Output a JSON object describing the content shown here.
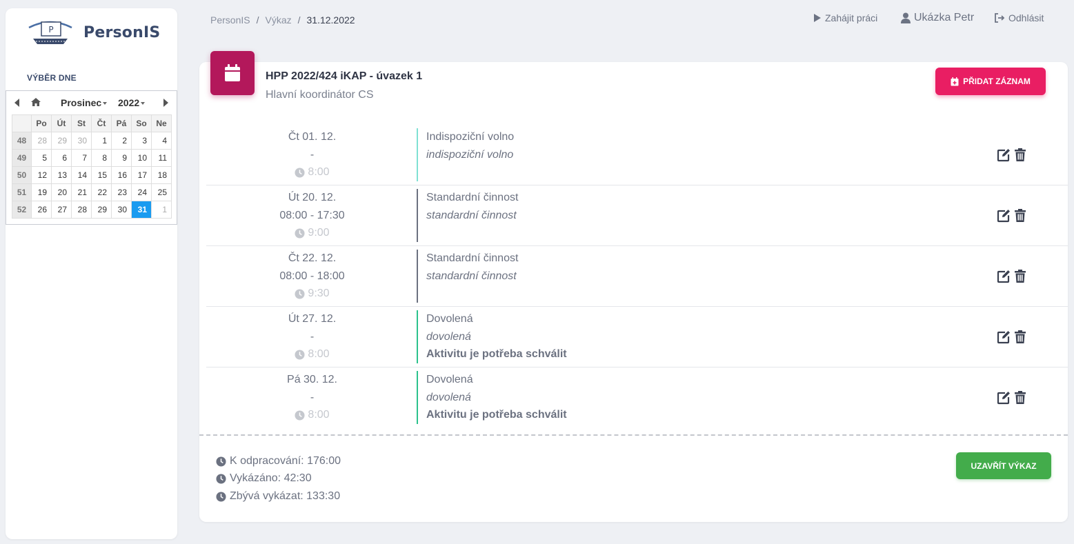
{
  "app": {
    "name": "PersonIS",
    "logo_letter": "P"
  },
  "sidebar": {
    "heading": "VÝBĚR DNE",
    "calendar": {
      "month": "Prosinec",
      "year": "2022",
      "weekdays": [
        "Po",
        "Út",
        "St",
        "Čt",
        "Pá",
        "So",
        "Ne"
      ],
      "weeks": [
        {
          "num": "48",
          "days": [
            "28",
            "29",
            "30",
            "1",
            "2",
            "3",
            "4"
          ]
        },
        {
          "num": "49",
          "days": [
            "5",
            "6",
            "7",
            "8",
            "9",
            "10",
            "11"
          ]
        },
        {
          "num": "50",
          "days": [
            "12",
            "13",
            "14",
            "15",
            "16",
            "17",
            "18"
          ]
        },
        {
          "num": "51",
          "days": [
            "19",
            "20",
            "21",
            "22",
            "23",
            "24",
            "25"
          ]
        },
        {
          "num": "52",
          "days": [
            "26",
            "27",
            "28",
            "29",
            "30",
            "31",
            "1"
          ]
        }
      ],
      "selected_day": "31",
      "selected_color": "#1a9bf0"
    }
  },
  "breadcrumb": {
    "items": [
      "PersonIS",
      "Výkaz"
    ],
    "current": "31.12.2022",
    "separator": "/"
  },
  "topnav": {
    "start_work": "Zahájit práci",
    "user": "Ukázka Petr",
    "logout": "Odhlásit"
  },
  "card": {
    "title": "HPP 2022/424 iKAP - úvazek 1",
    "subtitle": "Hlavní koordinátor CS",
    "add_button": "PŘIDAT ZÁZNAM",
    "icon": "calendar-icon",
    "icon_color": "#b3185b",
    "add_button_color": "#e91e63"
  },
  "entries": [
    {
      "date": "Čt 01. 12.",
      "time": "-",
      "hours": "8:00",
      "type": "Indispoziční volno",
      "desc": "indispoziční volno",
      "note": "",
      "bar_color": "#7fe0d3"
    },
    {
      "date": "Út 20. 12.",
      "time": "08:00 - 17:30",
      "hours": "9:00",
      "type": "Standardní činnost",
      "desc": "standardní činnost",
      "note": "",
      "bar_color": "#6b7180"
    },
    {
      "date": "Čt 22. 12.",
      "time": "08:00 - 18:00",
      "hours": "9:30",
      "type": "Standardní činnost",
      "desc": "standardní činnost",
      "note": "",
      "bar_color": "#6b7180"
    },
    {
      "date": "Út 27. 12.",
      "time": "-",
      "hours": "8:00",
      "type": "Dovolená",
      "desc": "dovolená",
      "note": "Aktivitu je potřeba schválit",
      "bar_color": "#2bc28c"
    },
    {
      "date": "Pá 30. 12.",
      "time": "-",
      "hours": "8:00",
      "type": "Dovolená",
      "desc": "dovolená",
      "note": "Aktivitu je potřeba schválit",
      "bar_color": "#2bc28c"
    }
  ],
  "summary": {
    "to_work": "K odpracování: 176:00",
    "reported": "Vykázáno: 42:30",
    "remaining": "Zbývá vykázat: 133:30",
    "close_button": "UZAVŘÍT VÝKAZ",
    "close_button_color": "#43ac4b"
  }
}
